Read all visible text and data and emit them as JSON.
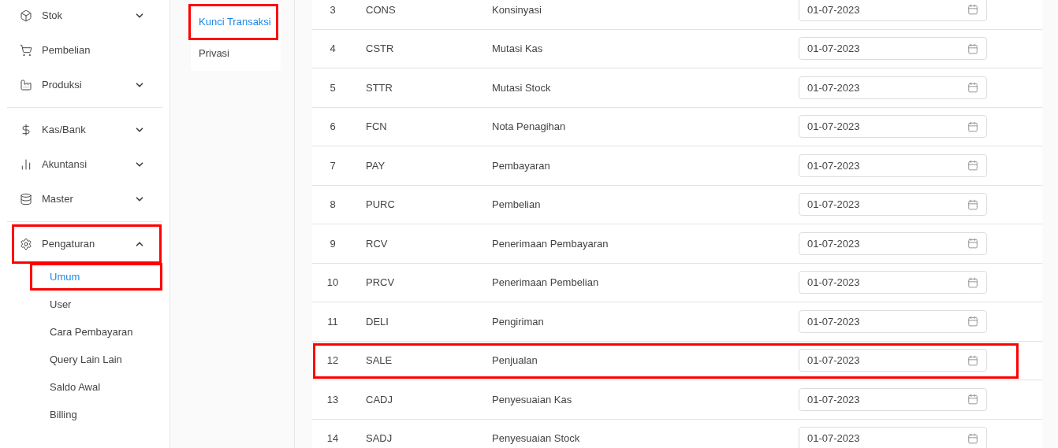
{
  "sidebar": {
    "groups": [
      {
        "items": [
          {
            "label": "Stok",
            "expandable": true,
            "expanded": false,
            "highlighted": false
          },
          {
            "label": "Pembelian",
            "expandable": false,
            "highlighted": false
          },
          {
            "label": "Produksi",
            "expandable": true,
            "expanded": false,
            "highlighted": false
          }
        ]
      },
      {
        "items": [
          {
            "label": "Kas/Bank",
            "expandable": true,
            "expanded": false,
            "highlighted": false
          },
          {
            "label": "Akuntansi",
            "expandable": true,
            "expanded": false,
            "highlighted": false
          },
          {
            "label": "Master",
            "expandable": true,
            "expanded": false,
            "highlighted": false
          }
        ]
      },
      {
        "items": [
          {
            "label": "Pengaturan",
            "expandable": true,
            "expanded": true,
            "highlighted": true,
            "children": [
              {
                "label": "Umum",
                "selected": true,
                "highlighted": true
              },
              {
                "label": "User",
                "selected": false,
                "highlighted": false
              },
              {
                "label": "Cara Pembayaran",
                "selected": false,
                "highlighted": false
              },
              {
                "label": "Query Lain Lain",
                "selected": false,
                "highlighted": false
              },
              {
                "label": "Saldo Awal",
                "selected": false,
                "highlighted": false
              },
              {
                "label": "Billing",
                "selected": false,
                "highlighted": false
              }
            ]
          }
        ]
      }
    ]
  },
  "settings_tabs": [
    {
      "label": "Kunci Transaksi",
      "selected": true,
      "highlighted": true
    },
    {
      "label": "Privasi",
      "selected": false,
      "highlighted": false
    }
  ],
  "table": {
    "rows": [
      {
        "no": "3",
        "code": "CONS",
        "name": "Konsinyasi",
        "date": "01-07-2023",
        "highlighted": false
      },
      {
        "no": "4",
        "code": "CSTR",
        "name": "Mutasi Kas",
        "date": "01-07-2023",
        "highlighted": false
      },
      {
        "no": "5",
        "code": "STTR",
        "name": "Mutasi Stock",
        "date": "01-07-2023",
        "highlighted": false
      },
      {
        "no": "6",
        "code": "FCN",
        "name": "Nota Penagihan",
        "date": "01-07-2023",
        "highlighted": false
      },
      {
        "no": "7",
        "code": "PAY",
        "name": "Pembayaran",
        "date": "01-07-2023",
        "highlighted": false
      },
      {
        "no": "8",
        "code": "PURC",
        "name": "Pembelian",
        "date": "01-07-2023",
        "highlighted": false
      },
      {
        "no": "9",
        "code": "RCV",
        "name": "Penerimaan Pembayaran",
        "date": "01-07-2023",
        "highlighted": false
      },
      {
        "no": "10",
        "code": "PRCV",
        "name": "Penerimaan Pembelian",
        "date": "01-07-2023",
        "highlighted": false
      },
      {
        "no": "11",
        "code": "DELI",
        "name": "Pengiriman",
        "date": "01-07-2023",
        "highlighted": false
      },
      {
        "no": "12",
        "code": "SALE",
        "name": "Penjualan",
        "date": "01-07-2023",
        "highlighted": true
      },
      {
        "no": "13",
        "code": "CADJ",
        "name": "Penyesuaian Kas",
        "date": "01-07-2023",
        "highlighted": false
      },
      {
        "no": "14",
        "code": "SADJ",
        "name": "Penyesuaian Stock",
        "date": "01-07-2023",
        "highlighted": false
      }
    ]
  }
}
